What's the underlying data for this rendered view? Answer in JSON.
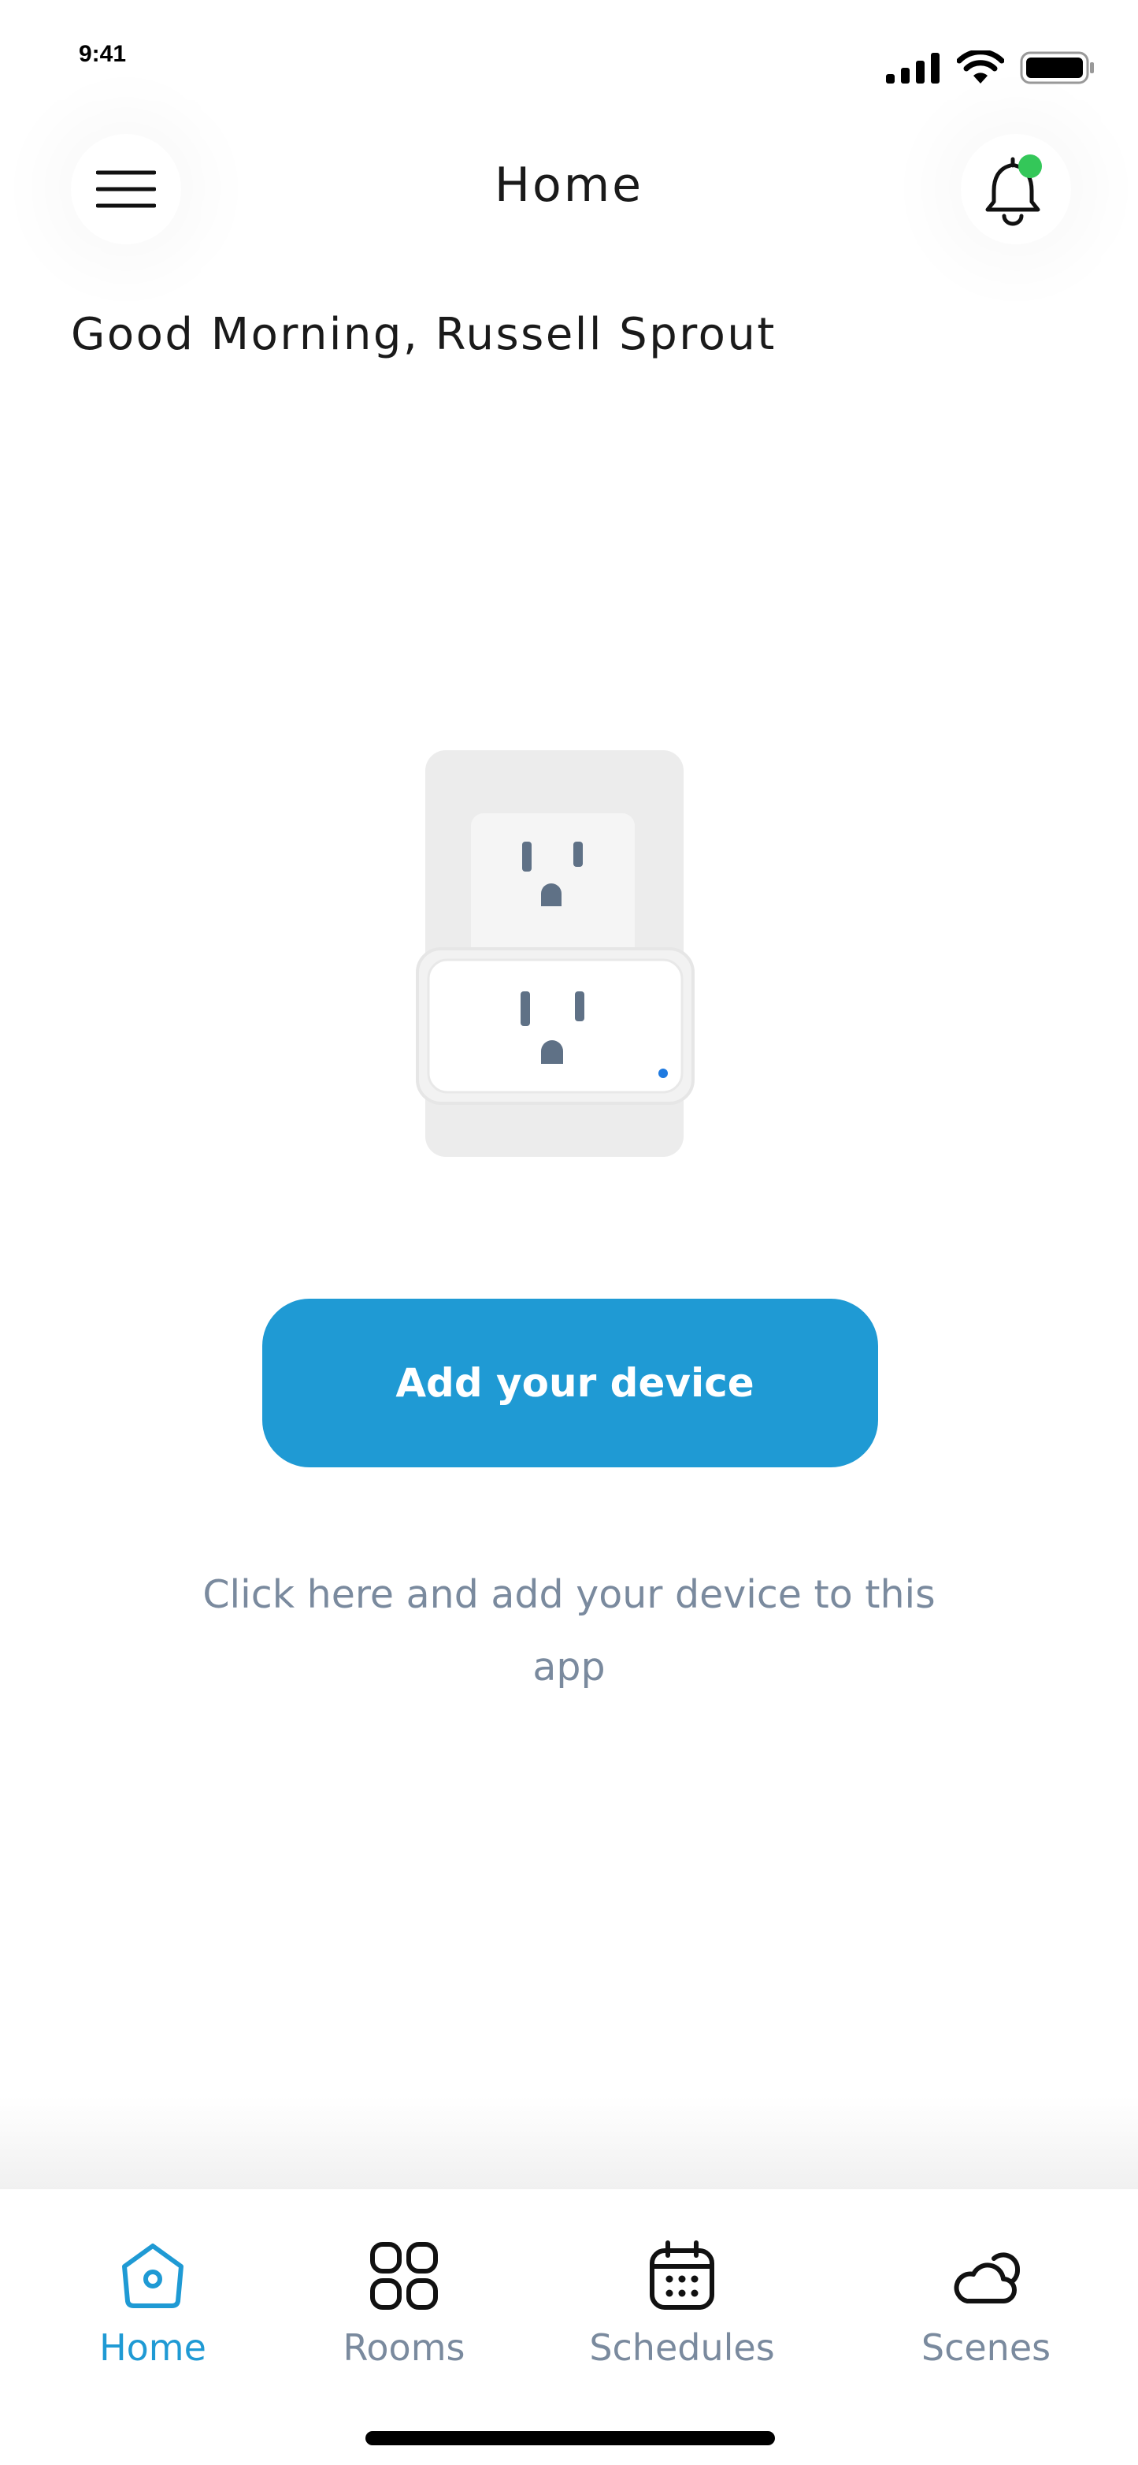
{
  "status_bar": {
    "time": "9:41"
  },
  "header": {
    "title": "Home",
    "menu_icon": "hamburger-menu-icon",
    "notification_icon": "bell-icon",
    "notification_dot_color": "#34c759"
  },
  "greeting": "Good Morning, Russell Sprout",
  "empty_state": {
    "illustration": "smart-plug-outlet",
    "button_label": "Add your device",
    "helper_text": "Click here and add your device to this app"
  },
  "colors": {
    "accent": "#1f9ad4",
    "muted_text": "#7a8a9e"
  },
  "bottom_nav": {
    "items": [
      {
        "label": "Home",
        "icon": "home-icon",
        "active": true
      },
      {
        "label": "Rooms",
        "icon": "rooms-grid-icon",
        "active": false
      },
      {
        "label": "Schedules",
        "icon": "calendar-icon",
        "active": false
      },
      {
        "label": "Scenes",
        "icon": "cloud-sun-icon",
        "active": false
      }
    ]
  }
}
